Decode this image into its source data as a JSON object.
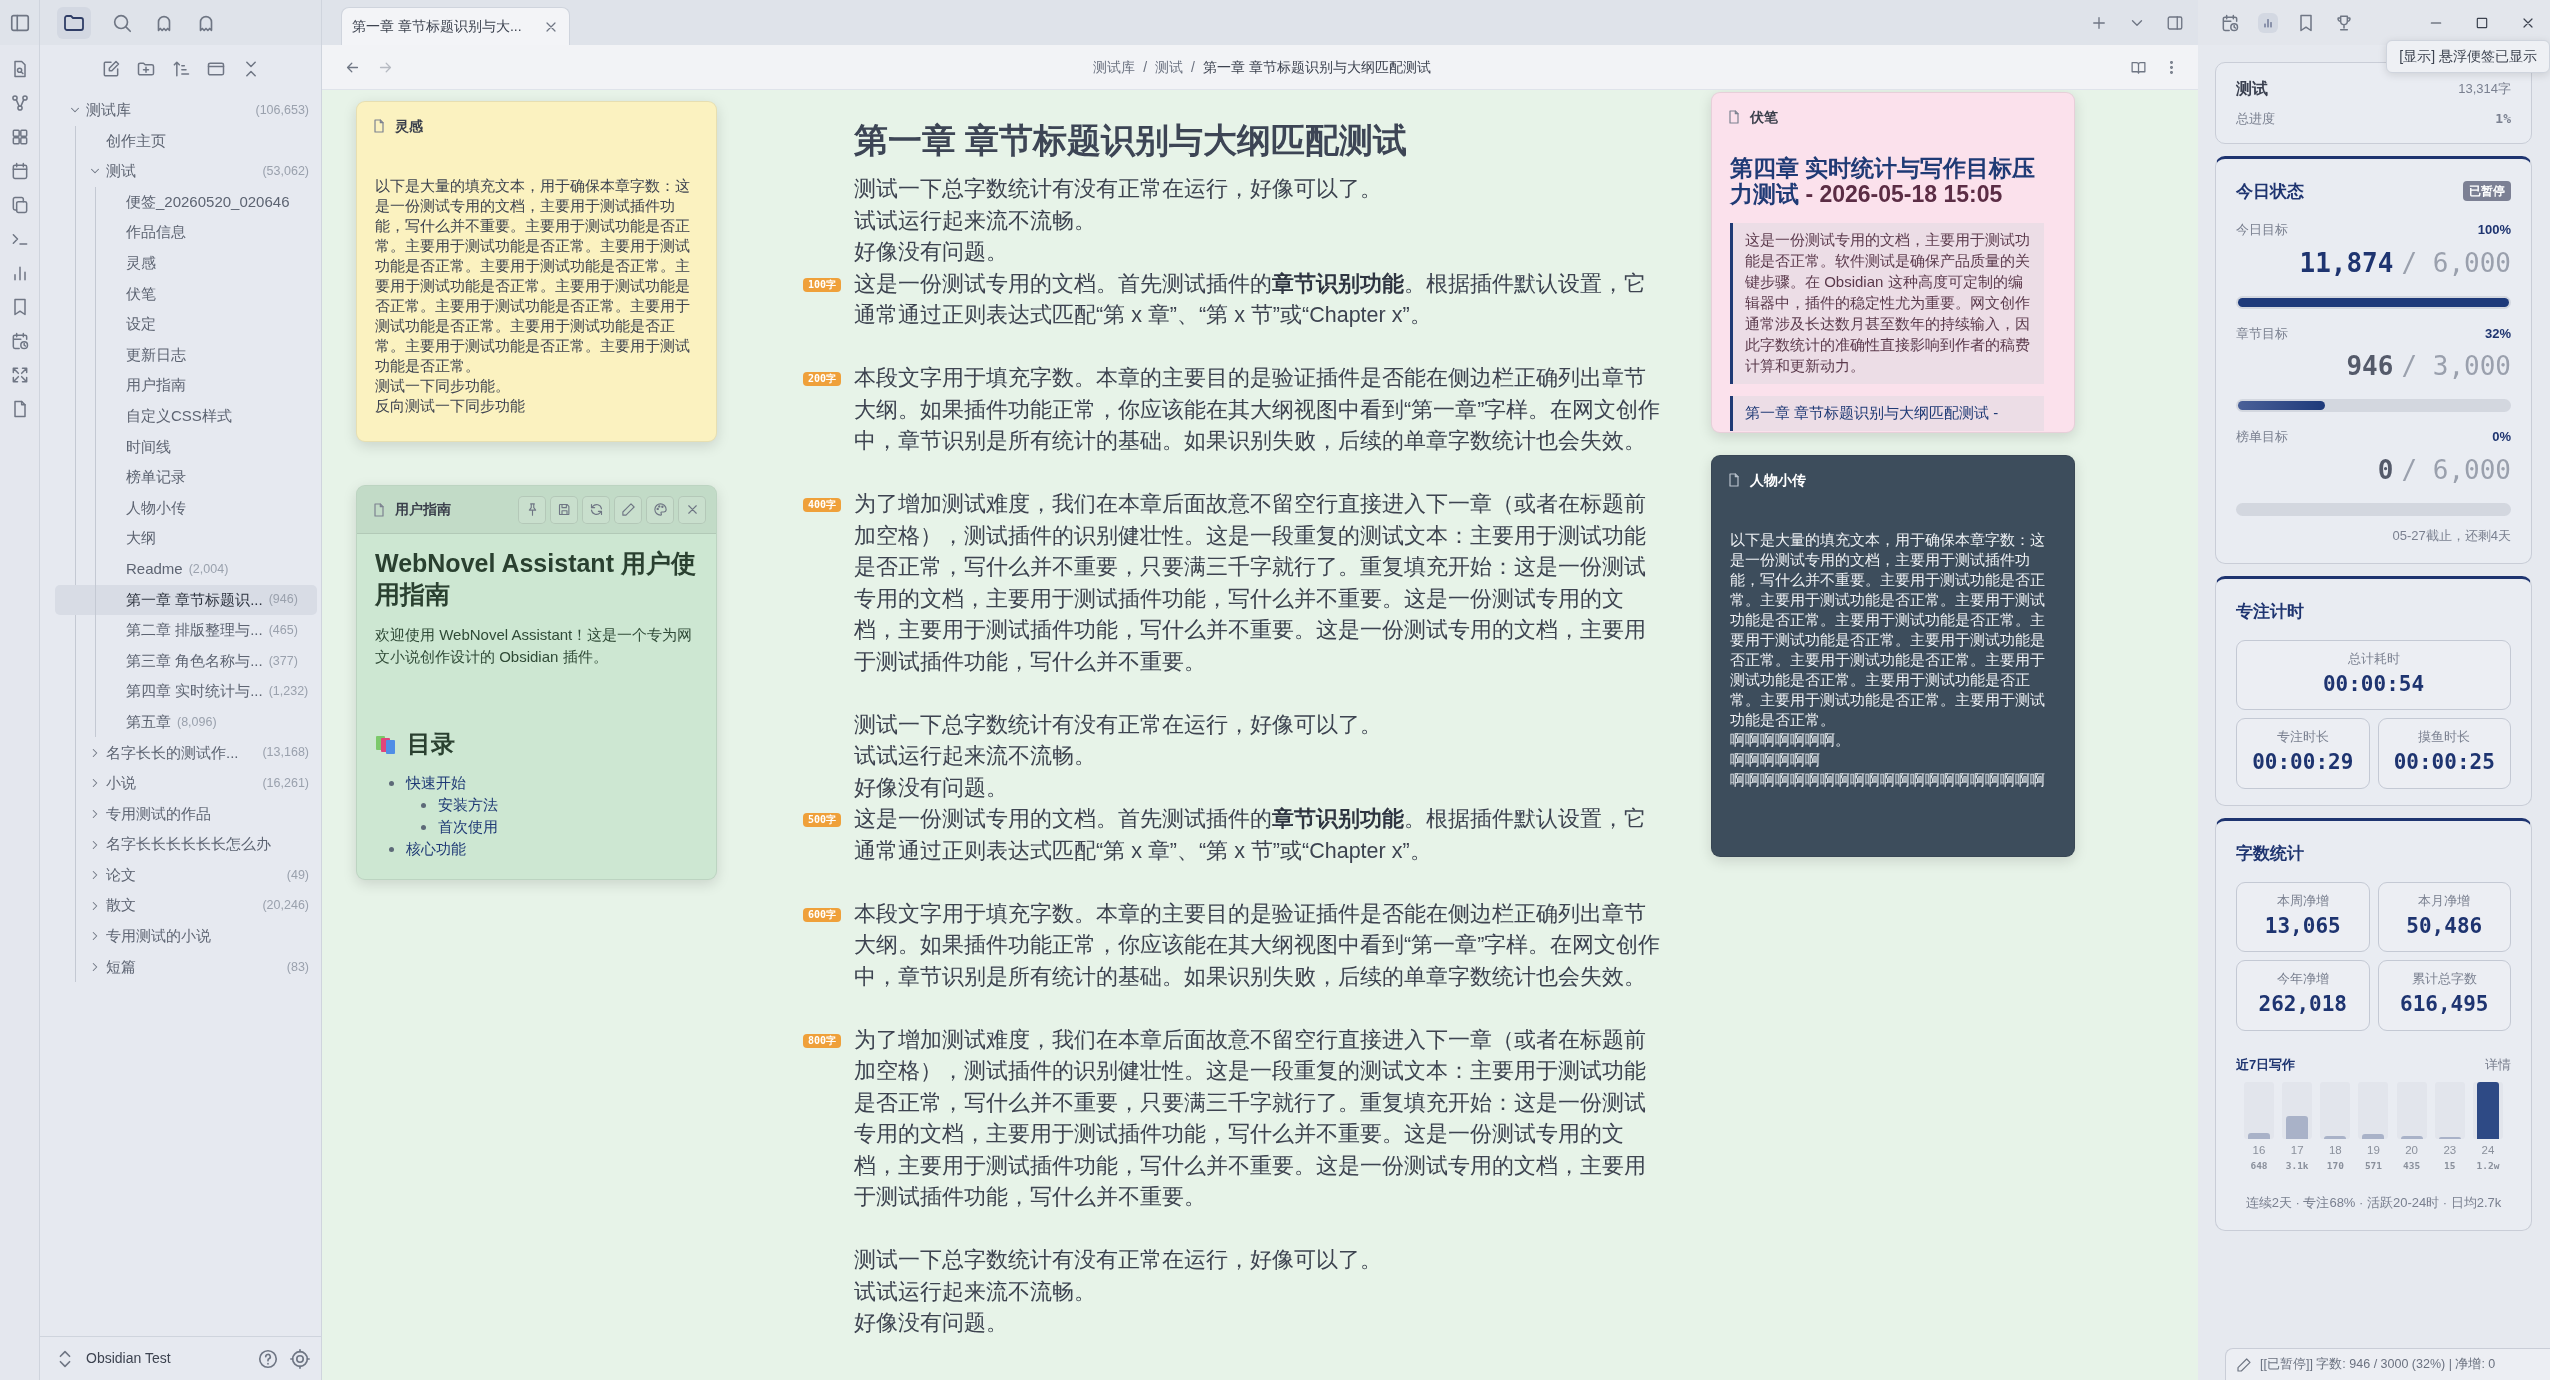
{
  "sidebar": {
    "tree": [
      {
        "label": "测试库",
        "count": "(106,653)",
        "expanded": true,
        "selected": false,
        "children": [
          {
            "label": "创作主页",
            "selected": false
          },
          {
            "label": "测试",
            "count": "(53,062)",
            "expanded": true,
            "selected": false,
            "children": [
              {
                "label": "便签_20260520_020646",
                "selected": false
              },
              {
                "label": "作品信息",
                "selected": false
              },
              {
                "label": "灵感",
                "selected": false
              },
              {
                "label": "伏笔",
                "selected": false
              },
              {
                "label": "设定",
                "selected": false
              },
              {
                "label": "更新日志",
                "selected": false
              },
              {
                "label": "用户指南",
                "selected": false
              },
              {
                "label": "自定义CSS样式",
                "selected": false
              },
              {
                "label": "时间线",
                "selected": false
              },
              {
                "label": "榜单记录",
                "selected": false
              },
              {
                "label": "人物小传",
                "selected": false
              },
              {
                "label": "大纲",
                "selected": false
              },
              {
                "label": "Readme",
                "count": "(2,004)",
                "selected": false
              },
              {
                "label": "第一章 章节标题识...",
                "count": "(946)",
                "selected": true
              },
              {
                "label": "第二章 排版整理与...",
                "count": "(465)",
                "selected": false
              },
              {
                "label": "第三章 角色名称与...",
                "count": "(377)",
                "selected": false
              },
              {
                "label": "第四章 实时统计与...",
                "count": "(1,232)",
                "selected": false
              },
              {
                "label": "第五章",
                "count": "(8,096)",
                "selected": false
              }
            ]
          },
          {
            "label": "名字长长的测试作...",
            "count": "(13,168)",
            "expanded": false,
            "selected": false
          },
          {
            "label": "小说",
            "count": "(16,261)",
            "expanded": false,
            "selected": false
          },
          {
            "label": "专用测试的作品",
            "expanded": false,
            "selected": false
          },
          {
            "label": "名字长长长长长长怎么办",
            "expanded": false,
            "selected": false
          },
          {
            "label": "论文",
            "count": "(49)",
            "expanded": false,
            "selected": false
          },
          {
            "label": "散文",
            "count": "(20,246)",
            "expanded": false,
            "selected": false
          },
          {
            "label": "专用测试的小说",
            "expanded": false,
            "selected": false
          },
          {
            "label": "短篇",
            "count": "(83)",
            "expanded": false,
            "selected": false
          }
        ]
      }
    ],
    "vault": "Obsidian Test"
  },
  "tab": {
    "title": "第一章 章节标题识别与大..."
  },
  "breadcrumb": {
    "separator": "/",
    "items": [
      "测试库",
      "测试",
      "第一章 章节标题识别与大纲匹配测试"
    ]
  },
  "editor": {
    "title": "第一章 章节标题识别与大纲匹配测试",
    "blocks": [
      {
        "kind": "line",
        "text": "测试一下总字数统计有没有正常在运行，好像可以了。"
      },
      {
        "kind": "line",
        "text": "试试运行起来流不流畅。"
      },
      {
        "kind": "line",
        "text": "好像没有问题。"
      },
      {
        "kind": "para",
        "badge": "100字",
        "text": "这是一份测试专用的文档。首先测试插件的**章节识别功能**。根据插件默认设置，它通常通过正则表达式匹配“第 x 章”、“第 x 节”或“Chapter x”。"
      },
      {
        "kind": "para",
        "badge": "200字",
        "text": "本段文字用于填充字数。本章的主要目的是验证插件是否能在侧边栏正确列出章节大纲。如果插件功能正常，你应该能在其大纲视图中看到“第一章”字样。在网文创作中，章节识别是所有统计的基础。如果识别失败，后续的单章字数统计也会失效。"
      },
      {
        "kind": "para",
        "badge": "400字",
        "text": "为了增加测试难度，我们在本章后面故意不留空行直接进入下一章（或者在标题前加空格），测试插件的识别健壮性。这是一段重复的测试文本：主要用于测试功能是否正常，写什么并不重要，只要满三千字就行了。重复填充开始：这是一份测试专用的文档，主要用于测试插件功能，写什么并不重要。这是一份测试专用的文档，主要用于测试插件功能，写什么并不重要。这是一份测试专用的文档，主要用于测试插件功能，写什么并不重要。"
      },
      {
        "kind": "line",
        "text": "测试一下总字数统计有没有正常在运行，好像可以了。"
      },
      {
        "kind": "line",
        "text": "试试运行起来流不流畅。"
      },
      {
        "kind": "line",
        "text": "好像没有问题。"
      },
      {
        "kind": "para",
        "badge": "500字",
        "text": "这是一份测试专用的文档。首先测试插件的**章节识别功能**。根据插件默认设置，它通常通过正则表达式匹配“第 x 章”、“第 x 节”或“Chapter x”。"
      },
      {
        "kind": "para",
        "badge": "600字",
        "text": "本段文字用于填充字数。本章的主要目的是验证插件是否能在侧边栏正确列出章节大纲。如果插件功能正常，你应该能在其大纲视图中看到“第一章”字样。在网文创作中，章节识别是所有统计的基础。如果识别失败，后续的单章字数统计也会失效。"
      },
      {
        "kind": "para",
        "badge": "800字",
        "text": "为了增加测试难度，我们在本章后面故意不留空行直接进入下一章（或者在标题前加空格），测试插件的识别健壮性。这是一段重复的测试文本：主要用于测试功能是否正常，写什么并不重要，只要满三千字就行了。重复填充开始：这是一份测试专用的文档，主要用于测试插件功能，写什么并不重要。这是一份测试专用的文档，主要用于测试插件功能，写什么并不重要。这是一份测试专用的文档，主要用于测试插件功能，写什么并不重要。"
      },
      {
        "kind": "line",
        "text": "测试一下总字数统计有没有正常在运行，好像可以了。"
      },
      {
        "kind": "line",
        "text": "试试运行起来流不流畅。"
      },
      {
        "kind": "line",
        "text": "好像没有问题。"
      }
    ]
  },
  "notes": [
    {
      "title": "灵感",
      "color": "#fbf2c0",
      "active": false,
      "blocks": [
        {
          "kind": "p",
          "text": "以下是大量的填充文本，用于确保本章字数：这是一份测试专用的文档，主要用于测试插件功能，写什么并不重要。主要用于测试功能是否正常。主要用于测试功能是否正常。主要用于测试功能是否正常。主要用于测试功能是否正常。主要用于测试功能是否正常。主要用于测试功能是否正常。主要用于测试功能是否正常。主要用于测试功能是否正常。主要用于测试功能是否正常。主要用于测试功能是否正常。主要用于测试功能是否正常。"
        },
        {
          "kind": "p",
          "text": "测试一下同步功能。"
        },
        {
          "kind": "p",
          "text": "反向测试一下同步功能"
        }
      ]
    },
    {
      "title": "用户指南",
      "color": "#cde7d2",
      "active": true,
      "blocks": [
        {
          "kind": "h1",
          "text": "WebNovel Assistant 用户使用指南"
        },
        {
          "kind": "p",
          "text": "欢迎使用 WebNovel Assistant！这是一个专为网文小说创作设计的 Obsidian 插件。"
        },
        {
          "kind": "h2icon",
          "text": "目录"
        },
        {
          "kind": "list",
          "items": [
            {
              "text": "快速开始",
              "children": [
                {
                  "text": "安装方法"
                },
                {
                  "text": "首次使用"
                }
              ]
            },
            {
              "text": "核心功能"
            }
          ]
        }
      ]
    },
    {
      "title": "伏笔",
      "color": "#fbe1ec",
      "active": false,
      "blocks": [
        {
          "kind": "h2",
          "text": "第四章 实时统计与写作目标压力测试",
          "suffix": "- 2026-05-18 15:05"
        },
        {
          "kind": "quote",
          "text": "这是一份测试专用的文档，主要用于测试功能是否正常。软件测试是确保产品质量的关键步骤。在 Obsidian 这种高度可定制的编辑器中，插件的稳定性尤为重要。网文创作通常涉及长达数月甚至数年的持续输入，因此字数统计的准确性直接影响到作者的稿费计算和更新动力。"
        },
        {
          "kind": "linkquote",
          "text": "第一章 章节标题识别与大纲匹配测试 -"
        }
      ]
    },
    {
      "title": "人物小传",
      "color": "#3d4d5c",
      "active": false,
      "blocks": [
        {
          "kind": "p",
          "text": "以下是大量的填充文本，用于确保本章字数：这是一份测试专用的文档，主要用于测试插件功能，写什么并不重要。主要用于测试功能是否正常。主要用于测试功能是否正常。主要用于测试功能是否正常。主要用于测试功能是否正常。主要用于测试功能是否正常。主要用于测试功能是否正常。主要用于测试功能是否正常。主要用于测试功能是否正常。主要用于测试功能是否正常。主要用于测试功能是否正常。主要用于测试功能是否正常。"
        },
        {
          "kind": "p",
          "text": "啊啊啊啊啊啊啊。"
        },
        {
          "kind": "p",
          "text": "啊啊啊啊啊啊"
        },
        {
          "kind": "p",
          "text": "啊啊啊啊啊啊啊啊啊啊啊啊啊啊啊啊啊啊啊啊啊"
        }
      ]
    }
  ],
  "tooltip": "[显示] 悬浮便签已显示",
  "stats": {
    "project": {
      "name": "测试",
      "words": "13,314字",
      "progress_label": "总进度",
      "progress": "1%"
    },
    "today": {
      "title": "今日状态",
      "badge": "已暂停",
      "goals": [
        {
          "label": "今日目标",
          "percent": "100%",
          "current": "11,874",
          "target": "/ 6,000",
          "level": 1
        },
        {
          "label": "章节目标",
          "percent": "32%",
          "current": "946",
          "target": "/ 3,000",
          "level": 0.32
        },
        {
          "label": "榜单目标",
          "percent": "0%",
          "current": "0",
          "target": "/ 6,000",
          "level": 0
        }
      ],
      "deadline": "05-27截止，还剩4天"
    },
    "focus": {
      "title": "专注计时",
      "total": {
        "label": "总计耗时",
        "value": "00:00:54"
      },
      "parts": [
        {
          "label": "专注时长",
          "value": "00:00:29"
        },
        {
          "label": "摸鱼时长",
          "value": "00:00:25"
        }
      ]
    },
    "words": {
      "title": "字数统计",
      "tiles": [
        {
          "label": "本周净增",
          "value": "13,065"
        },
        {
          "label": "本月净增",
          "value": "50,486"
        },
        {
          "label": "今年净增",
          "value": "262,018"
        },
        {
          "label": "累计总字数",
          "value": "616,495"
        }
      ],
      "week_title": "近7日写作",
      "details": "详情",
      "days": [
        {
          "day": "16",
          "count": "648",
          "level": 0.11,
          "current": false
        },
        {
          "day": "17",
          "count": "3.1k",
          "level": 0.4,
          "current": false
        },
        {
          "day": "18",
          "count": "170",
          "level": 0.05,
          "current": false
        },
        {
          "day": "19",
          "count": "571",
          "level": 0.08,
          "current": false
        },
        {
          "day": "20",
          "count": "435",
          "level": 0.06,
          "current": false
        },
        {
          "day": "23",
          "count": "15",
          "level": 0.03,
          "current": false
        },
        {
          "day": "24",
          "count": "1.2w",
          "level": 1,
          "current": true
        }
      ],
      "summary": "连续2天 · 专注68% · 活跃20-24时 · 日均2.7k"
    }
  },
  "status": "[[已暂停]] 字数: 946 / 3000 (32%) | 净增: 0"
}
